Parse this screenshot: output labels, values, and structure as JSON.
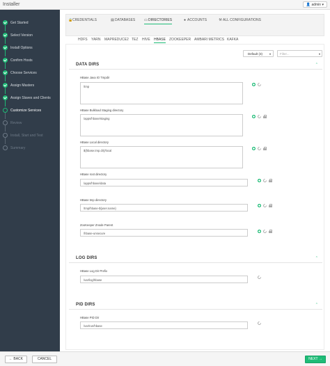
{
  "app": {
    "title": "Installer",
    "user": "admin"
  },
  "wizard": {
    "steps": [
      {
        "label": "Get Started",
        "state": "done"
      },
      {
        "label": "Select Version",
        "state": "done"
      },
      {
        "label": "Install Options",
        "state": "done"
      },
      {
        "label": "Confirm Hosts",
        "state": "done"
      },
      {
        "label": "Choose Services",
        "state": "done"
      },
      {
        "label": "Assign Masters",
        "state": "done"
      },
      {
        "label": "Assign Slaves and Clients",
        "state": "done"
      },
      {
        "label": "Customize Services",
        "state": "current"
      },
      {
        "label": "Review",
        "state": "todo"
      },
      {
        "label": "Install, Start and Test",
        "state": "todo"
      },
      {
        "label": "Summary",
        "state": "todo"
      }
    ]
  },
  "config_tabs": [
    {
      "label": "CREDENTIALS",
      "icon": "lock-icon"
    },
    {
      "label": "DATABASES",
      "icon": "database-icon"
    },
    {
      "label": "DIRECTORIES",
      "icon": "folder-icon",
      "active": true
    },
    {
      "label": "ACCOUNTS",
      "icon": "user-icon"
    },
    {
      "label": "ALL CONFIGURATIONS",
      "icon": "wrench-icon"
    }
  ],
  "service_tabs": [
    "HDFS",
    "YARN",
    "MAPREDUCE2",
    "TEZ",
    "HIVE",
    "HBASE",
    "ZOOKEEPER",
    "AMBARI METRICS",
    "KAFKA"
  ],
  "active_service": "HBASE",
  "toolbar": {
    "config_group": "Default (3)",
    "filter_placeholder": "Filter..."
  },
  "sections": {
    "data_dirs": {
      "title": "DATA DIRS",
      "fields": [
        {
          "label": "HBase Java IO Tmpdir",
          "value": "/tmp"
        },
        {
          "label": "HBase Bulkload Staging directory",
          "value": "/apps/hbase/staging"
        },
        {
          "label": "HBase Local directory",
          "value": "${hbase.tmp.dir}/local"
        },
        {
          "label": "HBase root directory",
          "value": "/apps/hbase/data"
        },
        {
          "label": "HBase tmp directory",
          "value": "/tmp/hbase-${user.name}"
        },
        {
          "label": "ZooKeeper Znode Parent",
          "value": "/hbase-unsecure"
        }
      ]
    },
    "log_dirs": {
      "title": "LOG DIRS",
      "fields": [
        {
          "label": "HBase Log Dir Prefix",
          "value": "/var/log/hbase"
        }
      ]
    },
    "pid_dirs": {
      "title": "PID DIRS",
      "fields": [
        {
          "label": "HBase PID Dir",
          "value": "/var/run/hbase"
        }
      ]
    }
  },
  "buttons": {
    "back": "← BACK",
    "cancel": "CANCEL",
    "next": "NEXT →"
  }
}
